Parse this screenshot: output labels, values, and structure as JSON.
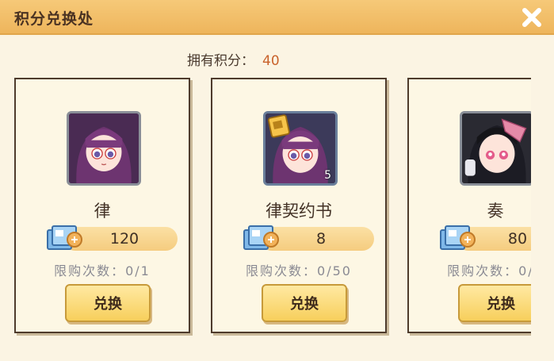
{
  "window": {
    "title": "积分兑换处",
    "close_icon": "close-x-icon"
  },
  "points": {
    "label": "拥有积分：",
    "value": "40"
  },
  "cards": [
    {
      "name": "律",
      "price": "120",
      "limit": "限购次数：0/1",
      "button": "兑换",
      "badge": "",
      "portrait": "girl-purple-hair-glasses"
    },
    {
      "name": "律契约书",
      "price": "8",
      "limit": "限购次数：0/50",
      "button": "兑换",
      "badge": "5",
      "portrait": "contract-book-girl"
    },
    {
      "name": "奏",
      "price": "80",
      "limit": "限购次数：0/1",
      "button": "兑换",
      "badge": "",
      "portrait": "girl-black-hair-pink"
    }
  ],
  "colors": {
    "accent": "#eeb55c",
    "points_value": "#c9622b",
    "button": "#f7cf5c"
  }
}
